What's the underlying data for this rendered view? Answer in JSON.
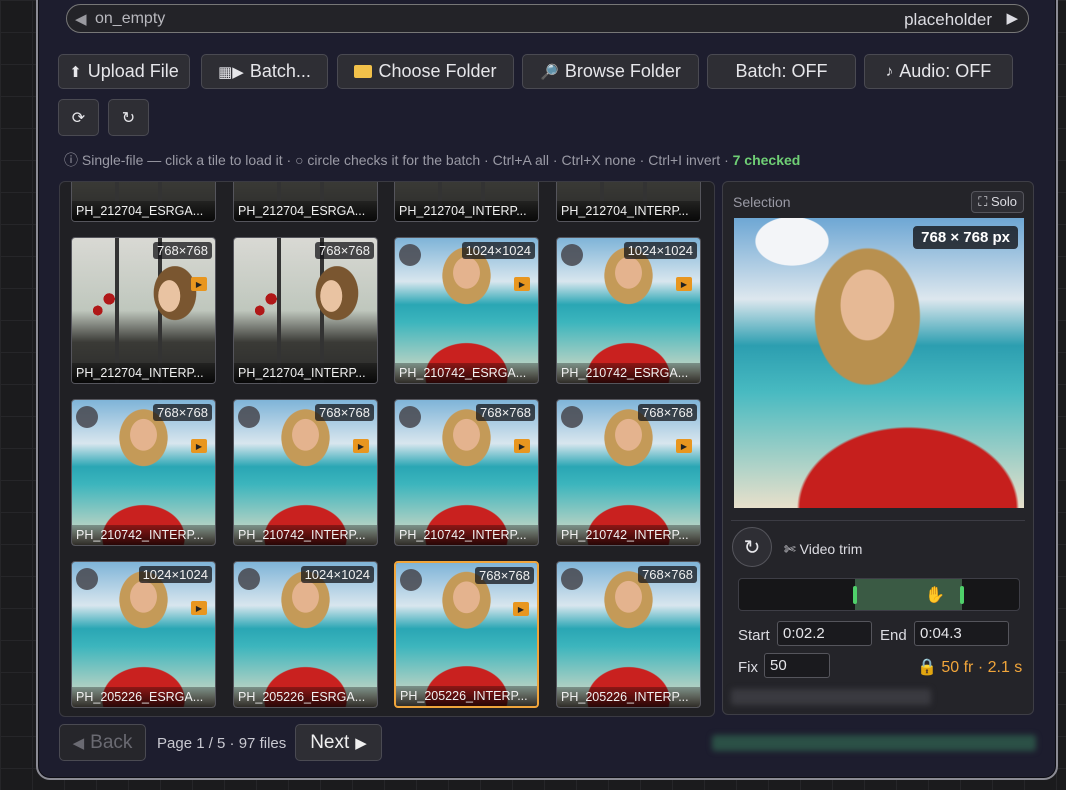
{
  "widget": {
    "label": "on_empty",
    "value": "placeholder"
  },
  "toolbar": {
    "upload": "Upload File",
    "batch": "Batch...",
    "choose_folder": "Choose Folder",
    "browse_folder": "Browse Folder",
    "batch_toggle": "Batch: OFF",
    "audio_toggle": "Audio: OFF"
  },
  "hint": {
    "text": "ⓘ Single-file — click a tile to load it · ○ circle checks it for the batch · Ctrl+A all · Ctrl+X none · Ctrl+I invert · ",
    "checked": "7 checked"
  },
  "tiles": [
    {
      "name": "PH_212704_ESRGA...",
      "dim": "",
      "bg": "window",
      "circle": false,
      "play": false
    },
    {
      "name": "PH_212704_ESRGA...",
      "dim": "",
      "bg": "window",
      "circle": false,
      "play": false
    },
    {
      "name": "PH_212704_INTERP...",
      "dim": "",
      "bg": "window",
      "circle": false,
      "play": false
    },
    {
      "name": "PH_212704_INTERP...",
      "dim": "",
      "bg": "window",
      "circle": false,
      "play": false
    },
    {
      "name": "PH_212704_INTERP...",
      "dim": "768×768",
      "bg": "window",
      "circle": false,
      "play": true
    },
    {
      "name": "PH_212704_INTERP...",
      "dim": "768×768",
      "bg": "window",
      "circle": false,
      "play": false
    },
    {
      "name": "PH_210742_ESRGA...",
      "dim": "1024×1024",
      "bg": "beach",
      "circle": true,
      "play": true
    },
    {
      "name": "PH_210742_ESRGA...",
      "dim": "1024×1024",
      "bg": "beach",
      "circle": true,
      "play": true
    },
    {
      "name": "PH_210742_INTERP...",
      "dim": "768×768",
      "bg": "beach",
      "circle": true,
      "play": true
    },
    {
      "name": "PH_210742_INTERP...",
      "dim": "768×768",
      "bg": "beach",
      "circle": true,
      "play": true
    },
    {
      "name": "PH_210742_INTERP...",
      "dim": "768×768",
      "bg": "beach",
      "circle": true,
      "play": true
    },
    {
      "name": "PH_210742_INTERP...",
      "dim": "768×768",
      "bg": "beach",
      "circle": true,
      "play": true
    },
    {
      "name": "PH_205226_ESRGA...",
      "dim": "1024×1024",
      "bg": "beach",
      "circle": true,
      "play": true
    },
    {
      "name": "PH_205226_ESRGA...",
      "dim": "1024×1024",
      "bg": "beach",
      "circle": true,
      "play": false
    },
    {
      "name": "PH_205226_INTERP...",
      "dim": "768×768",
      "bg": "beach",
      "circle": true,
      "play": true,
      "selected": true
    },
    {
      "name": "PH_205226_INTERP...",
      "dim": "768×768",
      "bg": "beach",
      "circle": true,
      "play": false
    }
  ],
  "panel": {
    "selection_label": "Selection",
    "solo": "⛶ Solo",
    "preview_dim": "768 × 768 px",
    "video_trim": "✄ Video trim",
    "trim_start_fraction": 0.41,
    "trim_end_fraction": 0.79,
    "start_label": "Start",
    "start_value": "0:02.2",
    "end_label": "End",
    "end_value": "0:04.3",
    "fix_label": "Fix",
    "fix_value": "50",
    "fps_info": "🔒 50 fr · 2.1 s"
  },
  "nav": {
    "back": "Back",
    "page_info": "Page 1 / 5 · 97 files",
    "next": "Next"
  },
  "colors": {
    "accent": "#f0a53b",
    "checked": "#6fcf75",
    "trim": "#4fd06a"
  }
}
